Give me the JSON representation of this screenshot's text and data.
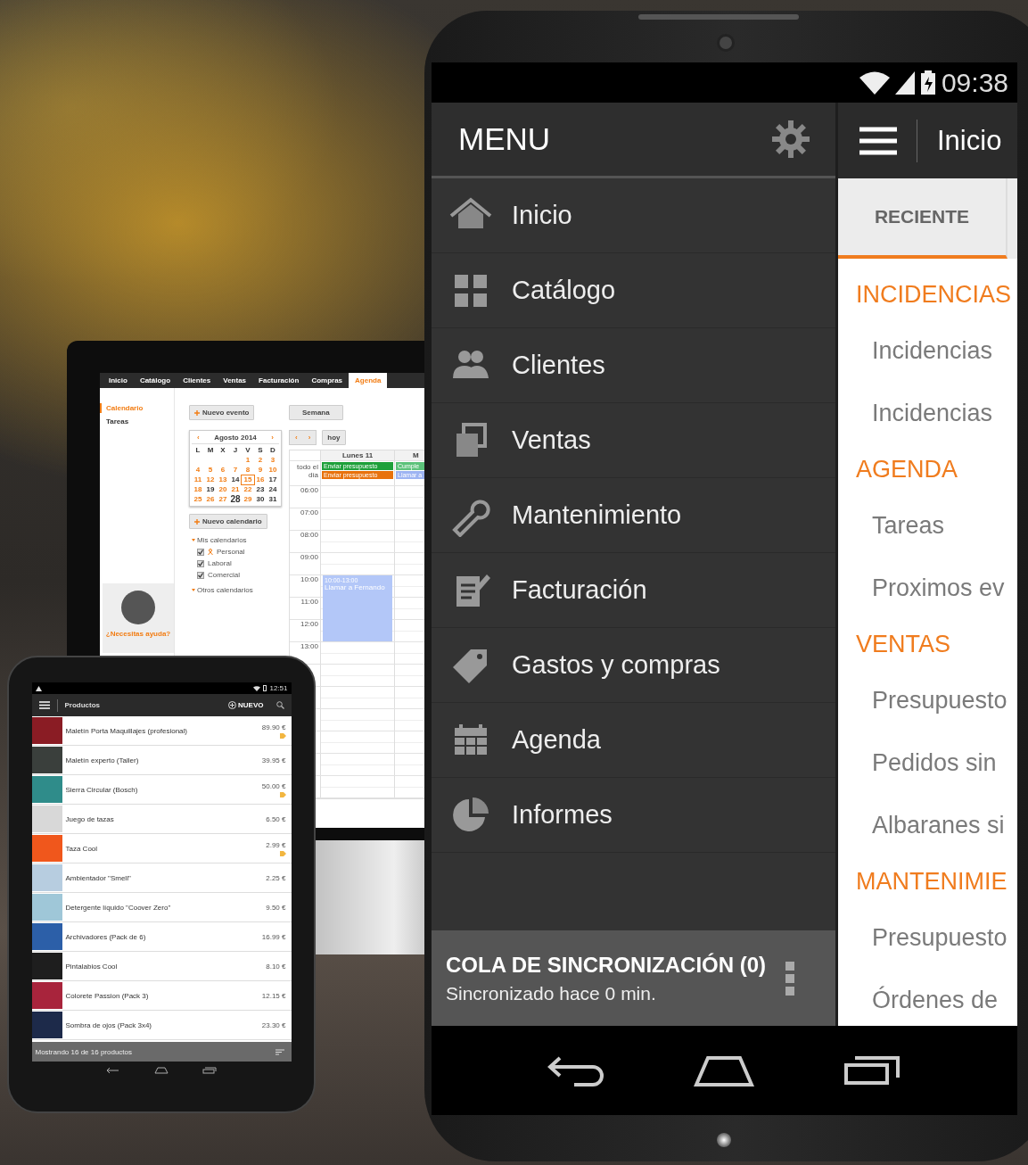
{
  "monitor": {
    "nav_tabs": [
      {
        "label": "Inicio",
        "selected": false
      },
      {
        "label": "Catálogo",
        "selected": false
      },
      {
        "label": "Clientes",
        "selected": false
      },
      {
        "label": "Ventas",
        "selected": false
      },
      {
        "label": "Facturación",
        "selected": false
      },
      {
        "label": "Compras",
        "selected": false
      },
      {
        "label": "Agenda",
        "selected": true
      }
    ],
    "sidebar": {
      "items": [
        {
          "label": "Calendario",
          "selected": true
        },
        {
          "label": "Tareas",
          "selected": false
        }
      ],
      "help": "¿Necesitas ayuda?"
    },
    "new_event_button": "Nuevo evento",
    "mini_calendar": {
      "prev": "‹",
      "month": "Agosto 2014",
      "next": "›",
      "weekdays": [
        "L",
        "M",
        "X",
        "J",
        "V",
        "S",
        "D"
      ],
      "days": [
        {
          "label": "1",
          "marked": true,
          "selected": false,
          "large": false
        },
        {
          "label": "2",
          "marked": true,
          "selected": false,
          "large": false
        },
        {
          "label": "3",
          "marked": true,
          "selected": false,
          "large": false
        },
        {
          "label": "4",
          "marked": true,
          "selected": false,
          "large": false
        },
        {
          "label": "5",
          "marked": true,
          "selected": false,
          "large": false
        },
        {
          "label": "6",
          "marked": true,
          "selected": false,
          "large": false
        },
        {
          "label": "7",
          "marked": true,
          "selected": false,
          "large": false
        },
        {
          "label": "8",
          "marked": true,
          "selected": false,
          "large": false
        },
        {
          "label": "9",
          "marked": true,
          "selected": false,
          "large": false
        },
        {
          "label": "10",
          "marked": true,
          "selected": false,
          "large": false
        },
        {
          "label": "11",
          "marked": true,
          "selected": false,
          "large": false
        },
        {
          "label": "12",
          "marked": true,
          "selected": false,
          "large": false
        },
        {
          "label": "13",
          "marked": true,
          "selected": false,
          "large": false
        },
        {
          "label": "14",
          "marked": false,
          "selected": false,
          "large": false
        },
        {
          "label": "15",
          "marked": true,
          "selected": true,
          "large": false
        },
        {
          "label": "16",
          "marked": true,
          "selected": false,
          "large": false
        },
        {
          "label": "17",
          "marked": false,
          "selected": false,
          "large": false
        },
        {
          "label": "18",
          "marked": true,
          "selected": false,
          "large": false
        },
        {
          "label": "19",
          "marked": false,
          "selected": false,
          "large": false
        },
        {
          "label": "20",
          "marked": true,
          "selected": false,
          "large": false
        },
        {
          "label": "21",
          "marked": true,
          "selected": false,
          "large": false
        },
        {
          "label": "22",
          "marked": true,
          "selected": false,
          "large": false
        },
        {
          "label": "23",
          "marked": false,
          "selected": false,
          "large": false
        },
        {
          "label": "24",
          "marked": false,
          "selected": false,
          "large": false
        },
        {
          "label": "25",
          "marked": true,
          "selected": false,
          "large": false
        },
        {
          "label": "26",
          "marked": true,
          "selected": false,
          "large": false
        },
        {
          "label": "27",
          "marked": true,
          "selected": false,
          "large": false
        },
        {
          "label": "28",
          "marked": false,
          "selected": false,
          "large": true
        },
        {
          "label": "29",
          "marked": true,
          "selected": false,
          "large": false
        },
        {
          "label": "30",
          "marked": false,
          "selected": false,
          "large": false
        },
        {
          "label": "31",
          "marked": false,
          "selected": false,
          "large": false
        }
      ]
    },
    "new_calendar_button": "Nuevo calendario",
    "calendar_groups": [
      {
        "title": "Mis calendarios",
        "items": [
          {
            "label": "Personal",
            "checked": true,
            "kind": "person"
          },
          {
            "label": "Laboral",
            "checked": true,
            "kind": "plain"
          },
          {
            "label": "Comercial",
            "checked": true,
            "kind": "plain"
          }
        ]
      },
      {
        "title": "Otros calendarios"
      }
    ],
    "view_button": "Semana",
    "prev": "‹",
    "next": "›",
    "today_button": "hoy",
    "day_columns": [
      {
        "header": "Lunes 11",
        "all_day": [
          {
            "label": "Enviar presupuesto",
            "color": "#1ea03a"
          },
          {
            "label": "Enviar presupuesto",
            "color": "#e8720c"
          }
        ]
      },
      {
        "header": "M",
        "all_day": [
          {
            "label": "Cumple",
            "color": "#5cc27a"
          },
          {
            "label": "Llamar a",
            "color": "#9db4f2"
          }
        ]
      }
    ],
    "all_day_label": "todo el día",
    "hours": [
      "06:00",
      "07:00",
      "08:00",
      "09:00",
      "10:00",
      "11:00",
      "12:00",
      "13:00"
    ],
    "event": {
      "time": "10:00-13:00",
      "title": "Llamar a Fernando"
    }
  },
  "tablet": {
    "time": "12:51",
    "title": "Productos",
    "new_button": "NUEVO",
    "products": [
      {
        "name": "Maletín Porta Maquillajes (profesional)",
        "price": "89.90 €",
        "featured": true,
        "color": "#8a1c24"
      },
      {
        "name": "Maletín experto (Taller)",
        "price": "39.95 €",
        "featured": false,
        "color": "#3a3f3c"
      },
      {
        "name": "Sierra Circular (Bosch)",
        "price": "50.00 €",
        "featured": true,
        "color": "#2f8c8a"
      },
      {
        "name": "Juego de tazas",
        "price": "6.50 €",
        "featured": false,
        "color": "#d8d8d8"
      },
      {
        "name": "Taza Cool",
        "price": "2.99 €",
        "featured": true,
        "color": "#f0571c"
      },
      {
        "name": "Ambientador \"Smell\"",
        "price": "2.25 €",
        "featured": false,
        "color": "#b7cde0"
      },
      {
        "name": "Detergente líquido \"Coover Zero\"",
        "price": "9.50 €",
        "featured": false,
        "color": "#9fc7d8"
      },
      {
        "name": "Archivadores (Pack de 6)",
        "price": "16.99 €",
        "featured": false,
        "color": "#2c5fa8"
      },
      {
        "name": "Pintalabios Cool",
        "price": "8.10 €",
        "featured": false,
        "color": "#1e1e1e"
      },
      {
        "name": "Colorete Passion (Pack 3)",
        "price": "12.15 €",
        "featured": false,
        "color": "#a8243c"
      },
      {
        "name": "Sombra de ojos (Pack 3x4)",
        "price": "23.30 €",
        "featured": false,
        "color": "#1d2a4a"
      }
    ],
    "footer": "Mostrando 16 de 16 productos"
  },
  "phone": {
    "time": "09:38",
    "menu_title": "MENU",
    "menu_items": [
      {
        "label": "Inicio",
        "kind": "house"
      },
      {
        "label": "Catálogo",
        "kind": "grid"
      },
      {
        "label": "Clientes",
        "kind": "people"
      },
      {
        "label": "Ventas",
        "kind": "windows"
      },
      {
        "label": "Mantenimiento",
        "kind": "wrench"
      },
      {
        "label": "Facturación",
        "kind": "edit"
      },
      {
        "label": "Gastos y compras",
        "kind": "tag"
      },
      {
        "label": "Agenda",
        "kind": "calendar"
      },
      {
        "label": "Informes",
        "kind": "pie"
      }
    ],
    "sync": {
      "title": "COLA DE SINCRONIZACIÓN (0)",
      "subtitle": "Sincronizado hace 0 min."
    },
    "app_title": "Inicio",
    "tabs": [
      {
        "label": "RECIENTE",
        "selected": true
      }
    ],
    "sections": [
      {
        "title": "INCIDENCIAS",
        "items": [
          "Incidencias",
          "Incidencias"
        ]
      },
      {
        "title": "AGENDA",
        "items": [
          "Tareas",
          "Proximos ev"
        ]
      },
      {
        "title": "VENTAS",
        "items": [
          "Presupuesto",
          "Pedidos sin",
          "Albaranes si"
        ]
      },
      {
        "title": "MANTENIMIE",
        "items": [
          "Presupuesto",
          "Órdenes de"
        ]
      }
    ]
  }
}
